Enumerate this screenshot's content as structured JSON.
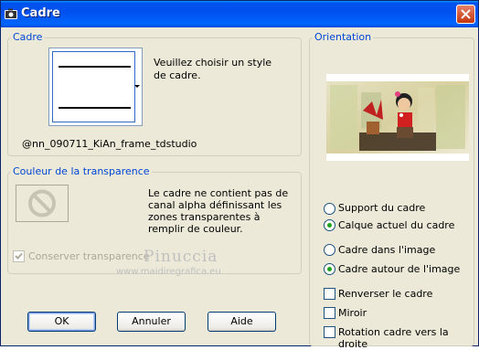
{
  "window": {
    "title": "Cadre"
  },
  "cadre": {
    "legend": "Cadre",
    "prompt": "Veuillez choisir un style de cadre.",
    "frame_name": "@nn_090711_KiAn_frame_tdstudio"
  },
  "transparency": {
    "legend": "Couleur de la transparence",
    "message": "Le cadre ne contient pas de canal alpha définissant les zones transparentes à remplir de couleur.",
    "keep_label": "Conserver transparence",
    "keep_checked": true
  },
  "orientation": {
    "legend": "Orientation",
    "support_label": "Support du cadre",
    "support_selected": false,
    "layer_label": "Calque actuel du cadre",
    "layer_selected": true,
    "inside_label": "Cadre dans l'image",
    "inside_selected": false,
    "around_label": "Cadre autour de l'image",
    "around_selected": true,
    "flip_label": "Renverser le cadre",
    "flip_checked": false,
    "mirror_label": "Miroir",
    "mirror_checked": false,
    "rotate_label": "Rotation cadre vers la droite",
    "rotate_checked": false
  },
  "buttons": {
    "ok": "OK",
    "cancel": "Annuler",
    "help": "Aide"
  },
  "watermark": {
    "name": "Pinuccia",
    "url": "www.maidiregrafica.eu"
  },
  "colors": {
    "accent": "#0046d5",
    "radio_dot": "#21a121",
    "title_bar": "#0053ee"
  }
}
